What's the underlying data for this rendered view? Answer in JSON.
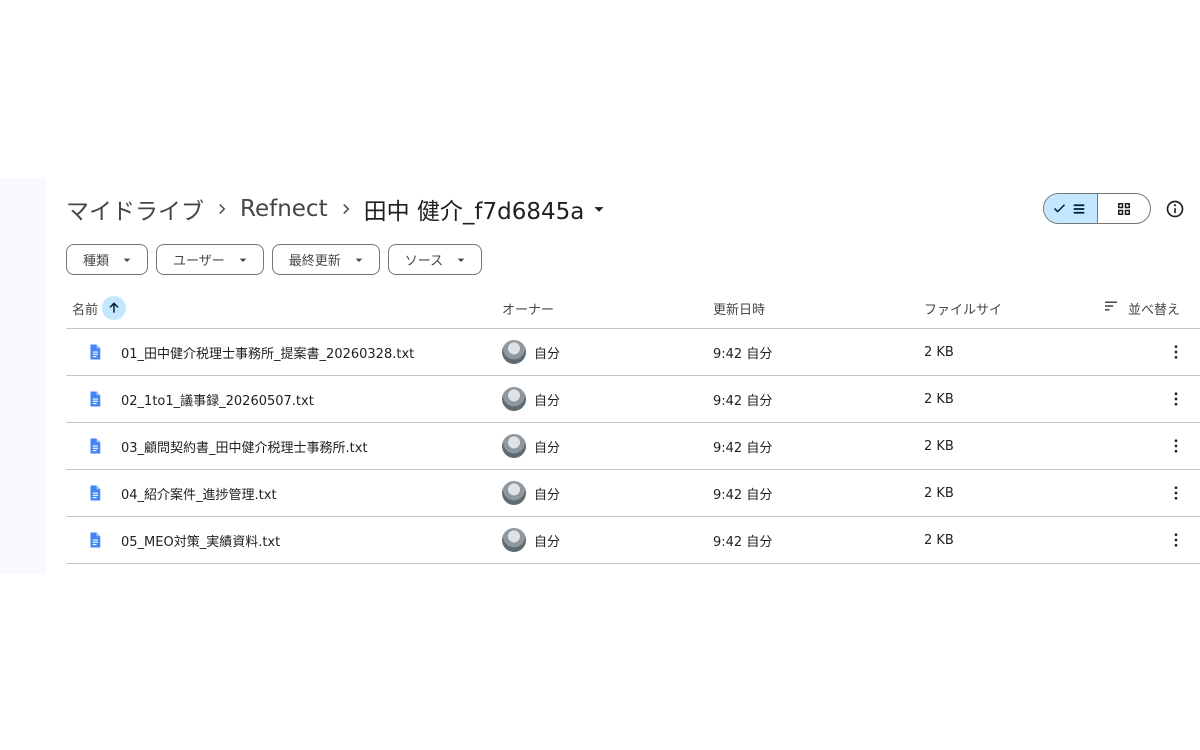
{
  "breadcrumb": {
    "root": "マイドライブ",
    "parent": "Refnect",
    "current": "田中 健介_f7d6845a"
  },
  "view": {
    "mode": "list"
  },
  "filters": [
    "種類",
    "ユーザー",
    "最終更新",
    "ソース"
  ],
  "columns": {
    "name": "名前",
    "owner": "オーナー",
    "modified": "更新日時",
    "size": "ファイルサイ",
    "sort": "並べ替え"
  },
  "files": [
    {
      "name": "01_田中健介税理士事務所_提案書_20260328.txt",
      "owner": "自分",
      "modified": "9:42 自分",
      "size": "2 KB"
    },
    {
      "name": "02_1to1_議事録_20260507.txt",
      "owner": "自分",
      "modified": "9:42 自分",
      "size": "2 KB"
    },
    {
      "name": "03_顧問契約書_田中健介税理士事務所.txt",
      "owner": "自分",
      "modified": "9:42 自分",
      "size": "2 KB"
    },
    {
      "name": "04_紹介案件_進捗管理.txt",
      "owner": "自分",
      "modified": "9:42 自分",
      "size": "2 KB"
    },
    {
      "name": "05_MEO対策_実績資料.txt",
      "owner": "自分",
      "modified": "9:42 自分",
      "size": "2 KB"
    }
  ],
  "colors": {
    "accent": "#c2e7ff",
    "doc_icon": "#4285f4",
    "divider": "#c4c7c5"
  }
}
